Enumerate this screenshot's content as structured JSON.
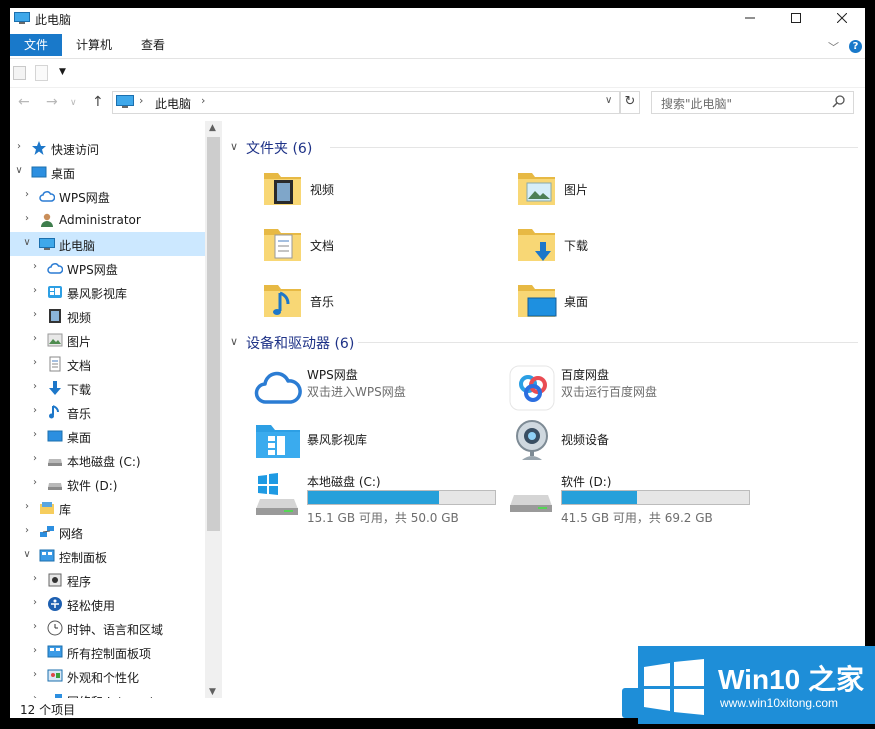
{
  "window": {
    "title": "此电脑",
    "minimize": "—",
    "maximize": "☐",
    "close": "✕"
  },
  "ribbon": {
    "tabs": [
      "文件",
      "计算机",
      "查看"
    ],
    "help": "?"
  },
  "address": {
    "crumb": "此电脑",
    "search_placeholder": "搜索\"此电脑\""
  },
  "nav": {
    "items": [
      {
        "label": "快速访问",
        "icon": "star-icon",
        "level": 0,
        "expanded": false
      },
      {
        "label": "桌面",
        "icon": "desktop-icon",
        "level": 0,
        "expanded": true
      },
      {
        "label": "WPS网盘",
        "icon": "cloud-icon",
        "level": 1,
        "expanded": false
      },
      {
        "label": "Administrator",
        "icon": "user-icon",
        "level": 1,
        "expanded": false
      },
      {
        "label": "此电脑",
        "icon": "computer-icon",
        "level": 1,
        "expanded": true,
        "selected": true
      },
      {
        "label": "WPS网盘",
        "icon": "cloud-icon",
        "level": 2,
        "expanded": false
      },
      {
        "label": "暴风影视库",
        "icon": "media-library-icon",
        "level": 2,
        "expanded": false
      },
      {
        "label": "视频",
        "icon": "video-icon",
        "level": 2,
        "expanded": false
      },
      {
        "label": "图片",
        "icon": "picture-icon",
        "level": 2,
        "expanded": false
      },
      {
        "label": "文档",
        "icon": "document-icon",
        "level": 2,
        "expanded": false
      },
      {
        "label": "下载",
        "icon": "download-icon",
        "level": 2,
        "expanded": false
      },
      {
        "label": "音乐",
        "icon": "music-icon",
        "level": 2,
        "expanded": false
      },
      {
        "label": "桌面",
        "icon": "desktop-icon",
        "level": 2,
        "expanded": false
      },
      {
        "label": "本地磁盘 (C:)",
        "icon": "drive-icon",
        "level": 2,
        "expanded": false
      },
      {
        "label": "软件 (D:)",
        "icon": "drive-icon",
        "level": 2,
        "expanded": false
      },
      {
        "label": "库",
        "icon": "library-icon",
        "level": 1,
        "expanded": false
      },
      {
        "label": "网络",
        "icon": "network-icon",
        "level": 1,
        "expanded": false
      },
      {
        "label": "控制面板",
        "icon": "control-panel-icon",
        "level": 1,
        "expanded": true
      },
      {
        "label": "程序",
        "icon": "programs-icon",
        "level": 2,
        "expanded": false
      },
      {
        "label": "轻松使用",
        "icon": "ease-of-access-icon",
        "level": 2,
        "expanded": false
      },
      {
        "label": "时钟、语言和区域",
        "icon": "clock-icon",
        "level": 2,
        "expanded": false
      },
      {
        "label": "所有控制面板项",
        "icon": "control-panel-icon",
        "level": 2,
        "expanded": false
      },
      {
        "label": "外观和个性化",
        "icon": "appearance-icon",
        "level": 2,
        "expanded": false
      },
      {
        "label": "网络和 Internet",
        "icon": "network-icon",
        "level": 2,
        "expanded": false
      }
    ]
  },
  "content": {
    "folders_header": "文件夹 (6)",
    "folders": [
      {
        "label": "视频",
        "icon": "video-folder-icon"
      },
      {
        "label": "图片",
        "icon": "picture-folder-icon"
      },
      {
        "label": "文档",
        "icon": "document-folder-icon"
      },
      {
        "label": "下载",
        "icon": "download-folder-icon"
      },
      {
        "label": "音乐",
        "icon": "music-folder-icon"
      },
      {
        "label": "桌面",
        "icon": "desktop-folder-icon"
      }
    ],
    "devices_header": "设备和驱动器 (6)",
    "devices": [
      {
        "name": "WPS网盘",
        "sub": "双击进入WPS网盘",
        "icon": "cloud-icon"
      },
      {
        "name": "百度网盘",
        "sub": "双击运行百度网盘",
        "icon": "baidu-netdisk-icon"
      },
      {
        "name": "暴风影视库",
        "sub": "",
        "icon": "media-library-icon"
      },
      {
        "name": "视频设备",
        "sub": "",
        "icon": "webcam-icon"
      },
      {
        "name": "本地磁盘 (C:)",
        "space": "15.1 GB 可用，共 50.0 GB",
        "used_fraction": 0.698,
        "icon": "windows-drive-icon"
      },
      {
        "name": "软件 (D:)",
        "space": "41.5 GB 可用，共 69.2 GB",
        "used_fraction": 0.4,
        "icon": "drive-icon"
      }
    ]
  },
  "status": {
    "count": "12 个项目"
  },
  "watermark": {
    "brand": "Win10 之家",
    "url": "www.win10xitong.com"
  },
  "colors": {
    "accent": "#1979ca",
    "selection": "#cce8ff",
    "group_title": "#1e3287",
    "drive_bar": "#26a0da",
    "folder_yellow": "#f8d775"
  }
}
